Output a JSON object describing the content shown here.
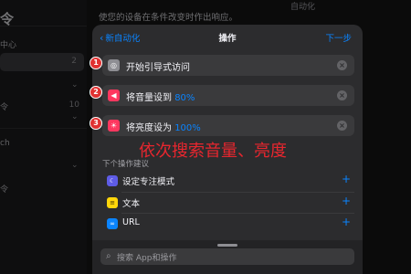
{
  "background": {
    "sidebar_title": "令",
    "header_right": "自动化",
    "description": "使您的设备在条件改变时作出响应。",
    "sidebar_items": [
      {
        "label": "中心",
        "count": ""
      },
      {
        "label": "",
        "count": "2"
      },
      {
        "label": "令",
        "count": "10"
      },
      {
        "label": "ch",
        "count": ""
      },
      {
        "label": "令",
        "count": ""
      }
    ]
  },
  "nav": {
    "back_label": "新自动化",
    "title": "操作",
    "next_label": "下一步"
  },
  "actions": [
    {
      "badge": "1",
      "icon": "guided-access-icon",
      "icon_color": "#8e8e93",
      "label": "开始引导式访问",
      "value": ""
    },
    {
      "badge": "2",
      "icon": "volume-icon",
      "icon_color": "#ff375f",
      "label": "将音量设到 ",
      "value": "80%"
    },
    {
      "badge": "3",
      "icon": "brightness-icon",
      "icon_color": "#ff375f",
      "label": "将亮度设为 ",
      "value": "100%"
    }
  ],
  "annotation": "依次搜索音量、亮度",
  "suggestions": {
    "header": "下个操作建议",
    "items": [
      {
        "label": "设定专注模式",
        "icon": "focus-moon-icon",
        "icon_color": "#5e5ce6"
      },
      {
        "label": "文本",
        "icon": "text-icon",
        "icon_color": "#ffd60a"
      },
      {
        "label": "URL",
        "icon": "link-icon",
        "icon_color": "#0a84ff"
      }
    ]
  },
  "search": {
    "placeholder": "搜索 App和操作"
  },
  "colors": {
    "accent": "#0a84ff",
    "badge": "#e03131",
    "annotation": "#e8262e"
  }
}
